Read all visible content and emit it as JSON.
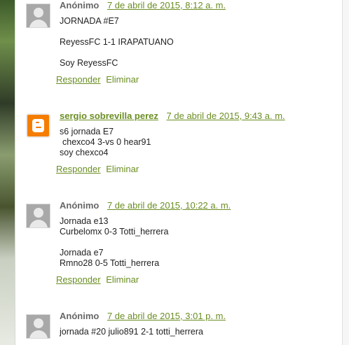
{
  "comments": [
    {
      "author": "Anónimo",
      "date": "7 de abril de 2015, 8:12 a. m.",
      "lines": [
        "JORNADA #E7",
        "ReyessFC 1-1 IRAPATUANO",
        "Soy ReyessFC"
      ],
      "reply_label": "Responder",
      "delete_label": "Eliminar"
    },
    {
      "author": "sergio sobrevilla perez",
      "date": "7 de abril de 2015, 9:43 a. m.",
      "lines": [
        "s6 jornada E7",
        "chexco4 3-vs 0 hear91",
        "soy chexco4"
      ],
      "reply_label": "Responder",
      "delete_label": "Eliminar"
    },
    {
      "author": "Anónimo",
      "date": "7 de abril de 2015, 10:22 a. m.",
      "lines": [
        "Jornada e13",
        "Curbelomx 0-3 Totti_herrera",
        "Jornada e7",
        "Rmno28 0-5 Totti_herrera"
      ],
      "reply_label": "Responder",
      "delete_label": "Eliminar"
    },
    {
      "author": "Anónimo",
      "date": "7 de abril de 2015, 3:01 p. m.",
      "lines": [
        "jornada #20 julio891 2-1 totti_herrera"
      ]
    }
  ]
}
